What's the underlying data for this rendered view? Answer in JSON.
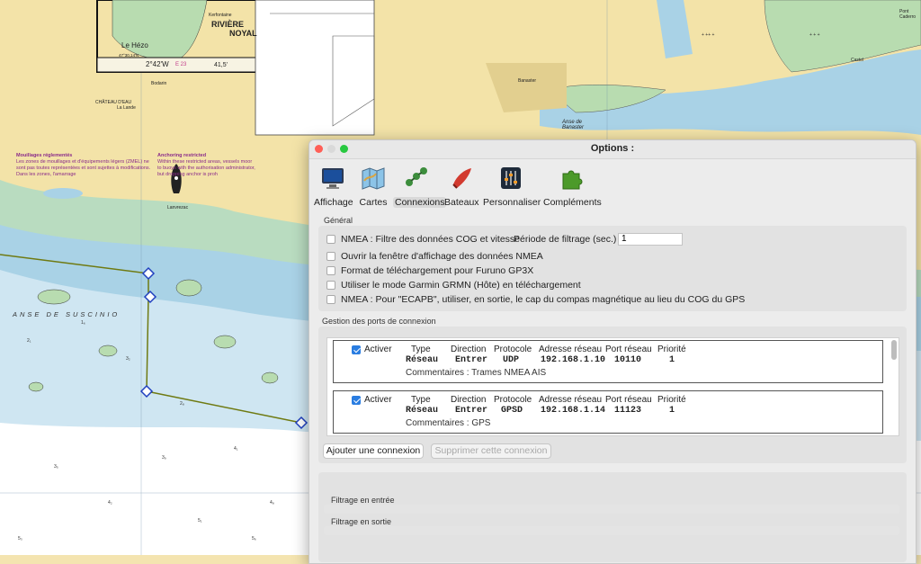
{
  "chart_background": {
    "colors": {
      "land": "#f3e3a8",
      "shallow": "#a9d2e6",
      "deep": "#ffffff",
      "green": "#b8dcb0",
      "route": "#6f7a12",
      "waypoint": "#1f3fbf"
    },
    "labels": {
      "anse_suscinio": "ANSE DE SUSCINIO",
      "le_hezo": "Le Hézo",
      "riviere": "RIVIÈRE",
      "noyal": "NOYAL",
      "kerfontaine": "Kerfontaine",
      "bodarin": "Bodarin",
      "chateau": "CHÂTEAU D'EAU",
      "la_lande": "La Lande",
      "banaster": "Banaster",
      "anse_banaster": "Anse de Banaster",
      "lanvrezac": "Lanvrezac",
      "coord_lon": "2°42'W",
      "coord_e": "E 23",
      "coord_val": "41,5'",
      "coord_small": "47°30,14'N",
      "pont_caderro": "Pont Caderro",
      "castel": "Castel"
    },
    "notes": {
      "mouillages_title": "Mouillages réglementés",
      "mouillages_text": "Les zones de mouillages et d'équipements légers (ZMEL) ne sont pas toutes représentées et sont sujettes à modifications. Dans les zones, l'amarrage",
      "anchoring_title": "Anchoring restricted",
      "anchoring_text": "Within these restricted areas, vessels moor to buoys with the authorisation administrator, but dropping anchor is proh"
    }
  },
  "window": {
    "title": "Options :",
    "traffic_colors": {
      "close": "#ff5f57",
      "min": "#d9d9d9",
      "max": "#28c840"
    },
    "toolbar": [
      {
        "label": "Affichage",
        "icon": "monitor-icon"
      },
      {
        "label": "Cartes",
        "icon": "map-icon"
      },
      {
        "label": "Connexions",
        "icon": "connections-icon",
        "selected": true
      },
      {
        "label": "Bateaux",
        "icon": "boat-icon"
      },
      {
        "label": "Personnaliser",
        "icon": "sliders-icon"
      },
      {
        "label": "Compléments",
        "icon": "puzzle-icon"
      }
    ],
    "general": {
      "section_label": "Général",
      "nmea_filter_label": "NMEA : Filtre des données COG et vitesse",
      "filter_period_label": "Période de filtrage (sec.)",
      "filter_period_value": "1",
      "options": [
        "Ouvrir la fenêtre d'affichage des données NMEA",
        "Format de téléchargement pour Furuno GP3X",
        "Utiliser le mode Garmin GRMN (Hôte) en téléchargement",
        "NMEA : Pour \"ECAPB\", utiliser, en sortie, le cap du compas magnétique  au lieu du COG du GPS"
      ]
    },
    "ports": {
      "section_label": "Gestion des ports de connexion",
      "headers": {
        "activer": "Activer",
        "type": "Type",
        "direction": "Direction",
        "protocole": "Protocole",
        "adresse": "Adresse réseau",
        "port": "Port réseau",
        "priorite": "Priorité"
      },
      "connections": [
        {
          "type": "Réseau",
          "direction": "Entrer",
          "protocole": "UDP",
          "adresse": "192.168.1.10",
          "port": "10110",
          "priorite": "1",
          "commentaire": "Commentaires : Trames NMEA AIS",
          "active": true
        },
        {
          "type": "Réseau",
          "direction": "Entrer",
          "protocole": "GPSD",
          "adresse": "192.168.1.14",
          "port": "11123",
          "priorite": "1",
          "commentaire": "Commentaires : GPS",
          "active": true
        }
      ],
      "add_button": "Ajouter une connexion",
      "remove_button": "Supprimer cette connexion"
    },
    "filters": {
      "input_label": "Filtrage en entrée",
      "output_label": "Filtrage en sortie"
    }
  }
}
